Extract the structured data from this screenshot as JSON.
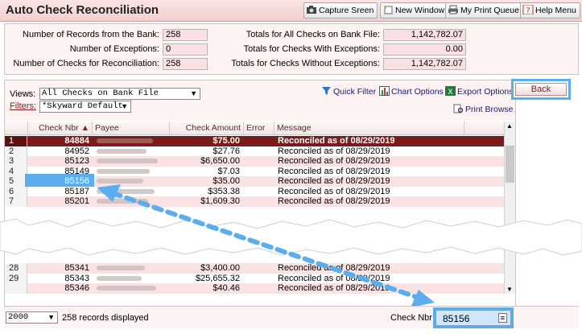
{
  "titlebar": {
    "title": "Auto Check Reconciliation",
    "buttons": [
      "Capture Sreen",
      "New Window",
      "My Print Queue",
      "Help Menu"
    ]
  },
  "summary": {
    "records_from_bank_label": "Number of Records from the Bank:",
    "records_from_bank": "258",
    "exceptions_label": "Number of Exceptions:",
    "exceptions": "0",
    "checks_recon_label": "Number of Checks for Reconciliation:",
    "checks_recon": "258",
    "totals_all_label": "Totals for All Checks on Bank File:",
    "totals_all": "1,142,782.07",
    "totals_with_label": "Totals for Checks With Exceptions:",
    "totals_with": "0.00",
    "totals_without_label": "Totals for Checks Without Exceptions:",
    "totals_without": "1,142,782.07"
  },
  "toolbar": {
    "views_label": "Views:",
    "views_value": "All Checks on Bank File",
    "filters_label": "Filters:",
    "filters_value": "*Skyward Default",
    "quick_filter": "Quick Filter",
    "chart_options": "Chart Options",
    "export_options": "Export Options",
    "back": "Back",
    "print_browse": "Print Browse"
  },
  "grid": {
    "columns": [
      "Check Nbr",
      "Payee",
      "Check Amount",
      "Error",
      "Message"
    ],
    "rows_top": [
      {
        "n": "1",
        "nbr": "84884",
        "amt": "$75.00",
        "msg": "Reconciled as of 08/29/2019"
      },
      {
        "n": "2",
        "nbr": "84952",
        "amt": "$27.76",
        "msg": "Reconciled as of 08/29/2019"
      },
      {
        "n": "3",
        "nbr": "85123",
        "amt": "$6,650.00",
        "msg": "Reconciled as of 08/29/2019"
      },
      {
        "n": "4",
        "nbr": "85149",
        "amt": "$7.03",
        "msg": "Reconciled as of 08/29/2019"
      },
      {
        "n": "5",
        "nbr": "85156",
        "amt": "$35.00",
        "msg": "Reconciled as of 08/29/2019"
      },
      {
        "n": "6",
        "nbr": "85187",
        "amt": "$353.38",
        "msg": "Reconciled as of 08/29/2019"
      },
      {
        "n": "7",
        "nbr": "85201",
        "amt": "$1,609.30",
        "msg": "Reconciled as of 08/29/2019"
      }
    ],
    "rows_bottom": [
      {
        "n": "28",
        "nbr": "85341",
        "amt": "$3,400.00",
        "msg": "Reconciled as of 08/29/2019"
      },
      {
        "n": "29",
        "nbr": "85343",
        "amt": "$25,655.32",
        "msg": "Reconciled as of 08/29/2019"
      },
      {
        "n": "",
        "nbr": "85346",
        "amt": "$40.46",
        "msg": "Reconciled as of 08/29/2019"
      }
    ]
  },
  "footer": {
    "page_size": "2000",
    "records_displayed": "258 records displayed",
    "check_nbr_label": "Check Nbr:",
    "check_nbr_value": "85156"
  }
}
